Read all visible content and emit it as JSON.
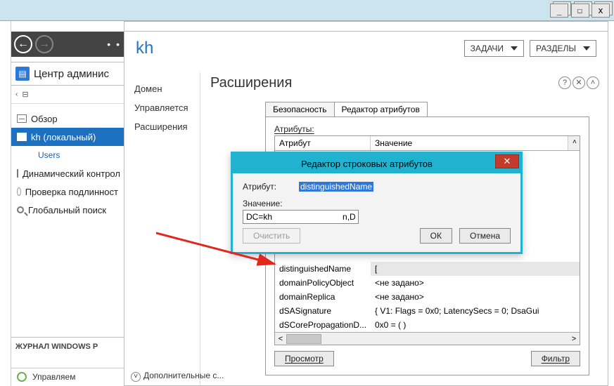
{
  "window": {
    "min": "_",
    "max": "☐",
    "close": "x"
  },
  "nav": {
    "back": "←",
    "fwd": "→",
    "more": "•  •"
  },
  "app_title": "Центр админис",
  "crumbs": {
    "icon": "⊟",
    "chev": "‹"
  },
  "tree": {
    "overview": "Обзор",
    "kh": "kh (локальный)",
    "users": "Users",
    "dyn": "Динамический контрол",
    "auth": "Проверка подлинност",
    "search": "Глобальный поиск"
  },
  "journal": "ЖУРНАЛ WINDOWS P",
  "manage": "Управляем",
  "right": {
    "title": "kh",
    "tasks": "ЗАДАЧИ",
    "sections": "РАЗДЕЛЫ",
    "nav": {
      "domain": "Домен",
      "managed": "Управляется",
      "ext": "Расширения"
    },
    "heading": "Расширения",
    "help": {
      "q": "?",
      "x": "✕",
      "c": "˄"
    }
  },
  "tabs": {
    "security": "Безопасность",
    "attr": "Редактор атрибутов"
  },
  "grid": {
    "caption": "Атрибуты:",
    "col1": "Атрибут",
    "col2": "Значение",
    "rows": [
      {
        "a": "distinguishedName",
        "v": "["
      },
      {
        "a": "domainPolicyObject",
        "v": "<не задано>"
      },
      {
        "a": "domainReplica",
        "v": "<не задано>"
      },
      {
        "a": "dSASignature",
        "v": "{ V1: Flags = 0x0; LatencySecs = 0; DsaGui"
      },
      {
        "a": "dSCorePropagationD...",
        "v": "0x0 = (  )"
      }
    ],
    "view": "Просмотр",
    "filter": "Фильтр"
  },
  "dialog": {
    "title": "Редактор строковых атрибутов",
    "attr_label": "Атрибут:",
    "attr_value": "distinguishedName",
    "value_label": "Значение:",
    "value": "DC=kh                              n,DC=ua",
    "clear": "Очистить",
    "ok": "ОК",
    "cancel": "Отмена"
  },
  "addl": "Дополнительные c..."
}
